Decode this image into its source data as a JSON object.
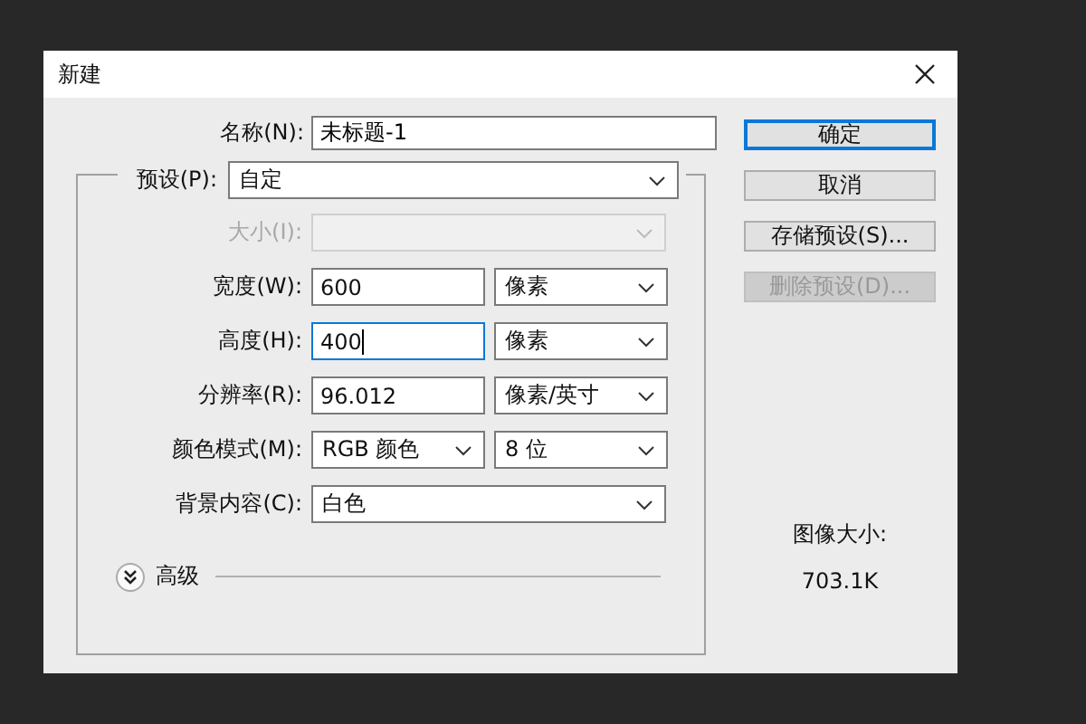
{
  "window": {
    "title": "新建"
  },
  "name": {
    "label": "名称(N):",
    "value": "未标题-1"
  },
  "preset": {
    "label": "预设(P):",
    "value": "自定"
  },
  "rows": [
    {
      "label": "大小(I):",
      "disabled": true,
      "fields": [
        {
          "kind": "wide-select"
        }
      ]
    },
    {
      "label": "宽度(W):",
      "disabled": false,
      "fields": [
        {
          "kind": "input",
          "value": "600",
          "focused": false
        },
        {
          "kind": "select",
          "value": "像素"
        }
      ]
    },
    {
      "label": "高度(H):",
      "disabled": false,
      "fields": [
        {
          "kind": "input",
          "value": "400",
          "focused": true
        },
        {
          "kind": "select",
          "value": "像素"
        }
      ]
    },
    {
      "label": "分辨率(R):",
      "disabled": false,
      "fields": [
        {
          "kind": "input",
          "value": "96.012",
          "focused": false
        },
        {
          "kind": "select",
          "value": "像素/英寸"
        }
      ]
    },
    {
      "label": "颜色模式(M):",
      "disabled": false,
      "fields": [
        {
          "kind": "select",
          "value": "RGB 颜色"
        },
        {
          "kind": "select",
          "value": "8 位"
        }
      ]
    },
    {
      "label": "背景内容(C):",
      "disabled": false,
      "fields": [
        {
          "kind": "wide-select",
          "value": "白色"
        }
      ]
    }
  ],
  "advanced": {
    "label": "高级",
    "expanded": false
  },
  "buttons": [
    {
      "label": "确定",
      "default": true,
      "disabled": false
    },
    {
      "label": "取消",
      "default": false,
      "disabled": false
    },
    {
      "label": "存储预设(S)...",
      "default": false,
      "disabled": false
    },
    {
      "label": "删除预设(D)...",
      "default": false,
      "disabled": true
    }
  ],
  "image_size": {
    "label": "图像大小:",
    "value": "703.1K"
  }
}
